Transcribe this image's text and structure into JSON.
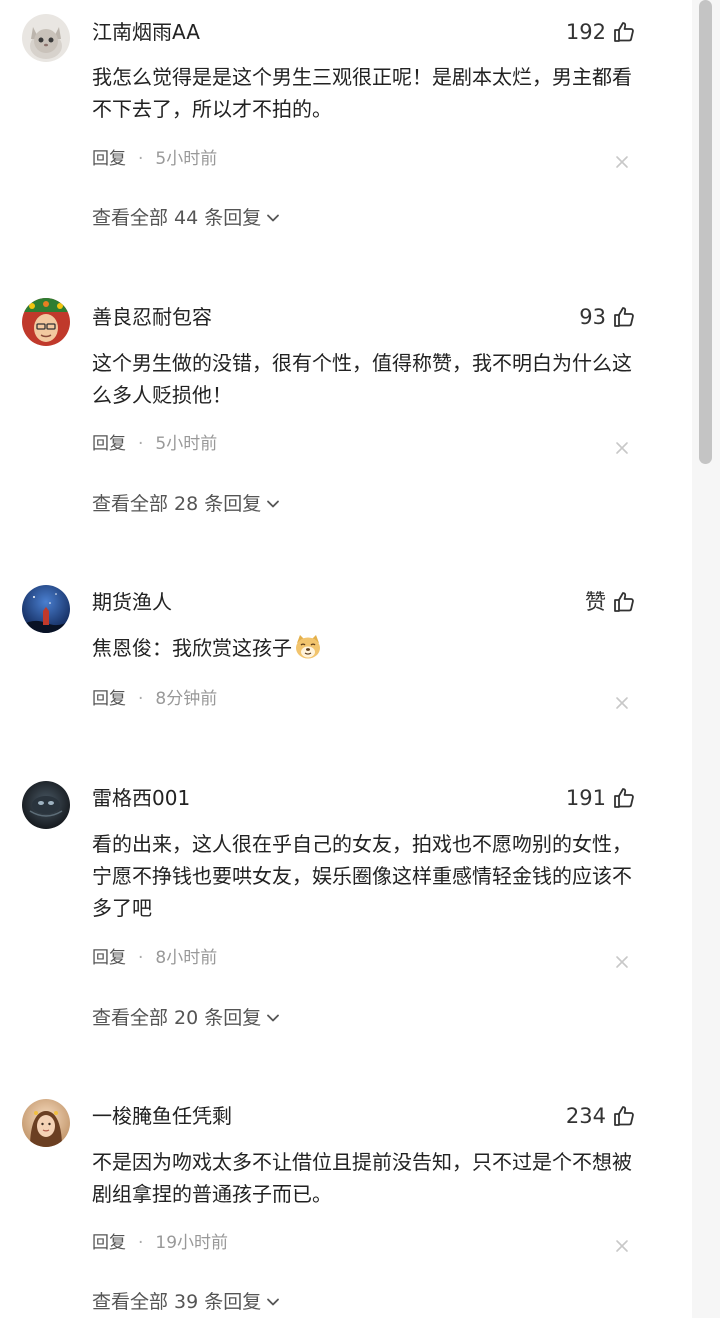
{
  "comments": [
    {
      "username": "江南烟雨AA",
      "likes": "192",
      "content": "我怎么觉得是是这个男生三观很正呢！是剧本太烂，男主都看不下去了，所以才不拍的。",
      "reply_label": "回复",
      "separator": "·",
      "time": "5小时前",
      "view_replies": "查看全部 44 条回复",
      "avatar_icon": "cat-avatar"
    },
    {
      "username": "善良忍耐包容",
      "likes": "93",
      "content": "这个男生做的没错，很有个性，值得称赞，我不明白为什么这么多人贬损他！",
      "reply_label": "回复",
      "separator": "·",
      "time": "5小时前",
      "view_replies": "查看全部 28 条回复",
      "avatar_icon": "person-avatar"
    },
    {
      "username": "期货渔人",
      "likes": "赞",
      "content": "焦恩俊：我欣赏这孩子",
      "reply_label": "回复",
      "separator": "·",
      "time": "8分钟前",
      "emoji_icon": "doge-emoji",
      "avatar_icon": "night-sky-avatar"
    },
    {
      "username": "雷格西001",
      "likes": "191",
      "content": "看的出来，这人很在乎自己的女友，拍戏也不愿吻别的女性，宁愿不挣钱也要哄女友，娱乐圈像这样重感情轻金钱的应该不多了吧",
      "reply_label": "回复",
      "separator": "·",
      "time": "8小时前",
      "view_replies": "查看全部 20 条回复",
      "avatar_icon": "dark-avatar"
    },
    {
      "username": "一梭腌鱼任凭剩",
      "likes": "234",
      "content": "不是因为吻戏太多不让借位且提前没告知，只不过是个不想被剧组拿捏的普通孩子而已。",
      "reply_label": "回复",
      "separator": "·",
      "time": "19小时前",
      "view_replies": "查看全部 39 条回复",
      "avatar_icon": "portrait-avatar"
    }
  ],
  "colors": {
    "text": "#222222",
    "secondary": "#555555",
    "muted": "#999999",
    "scrollbar": "#c4c4c4"
  },
  "icons": {
    "like": "thumbs-up-icon",
    "close": "close-icon",
    "expand": "chevron-down-icon"
  }
}
